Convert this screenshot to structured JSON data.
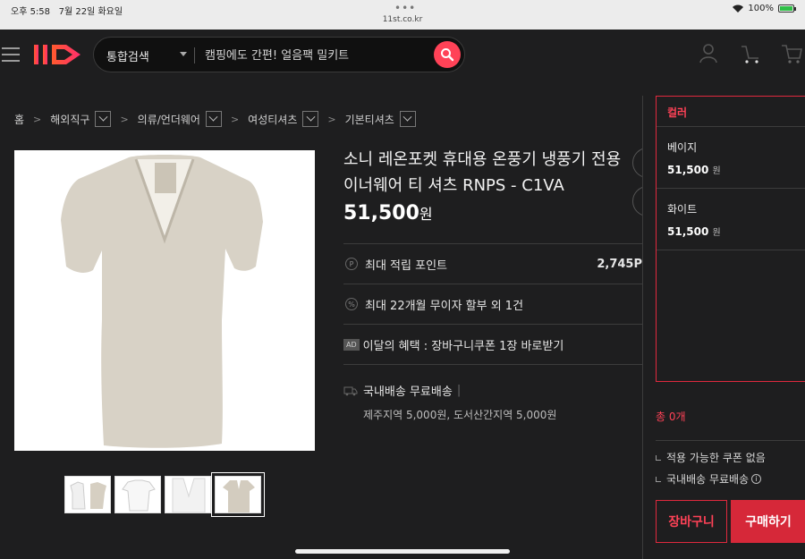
{
  "status_bar": {
    "time": "오후 5:58",
    "date": "7월 22일 화요일",
    "url": "11st.co.kr",
    "battery": "100%"
  },
  "header": {
    "search_category": "통합검색",
    "search_placeholder": "캠핑에도 간편! 얼음팩 밀키트"
  },
  "breadcrumb": [
    "홈",
    "해외직구",
    "의류/언더웨어",
    "여성티셔츠",
    "기본티셔츠"
  ],
  "product": {
    "title": "소니 레온포켓 휴대용 온풍기 냉풍기 전용 이너웨어 티 셔츠 RNPS - C1VA",
    "price": "51,500",
    "price_unit": "원",
    "point_label": "최대 적립 포인트",
    "point_value": "2,745P",
    "installment": "최대 22개월 무이자 할부 외 1건",
    "ad_badge": "AD",
    "benefit_month": "이달의 혜택 : 장바구니쿠폰 1장 바로받기",
    "shipping": "국내배송 무료배송",
    "shipping_extra": "제주지역 5,000원, 도서산간지역 5,000원"
  },
  "options": {
    "header": "컬러",
    "items": [
      {
        "name": "베이지",
        "price": "51,500",
        "unit": "원"
      },
      {
        "name": "화이트",
        "price": "51,500",
        "unit": "원"
      }
    ]
  },
  "summary": {
    "total": "총 0개",
    "coupon": "적용 가능한 쿠폰 없음",
    "shipping": "국내배송 무료배송",
    "cart_button": "장바구니",
    "buy_button": "구매하기"
  },
  "colors": {
    "accent": "#ff4257",
    "buy": "#d62839",
    "background": "#1e1e1f"
  }
}
